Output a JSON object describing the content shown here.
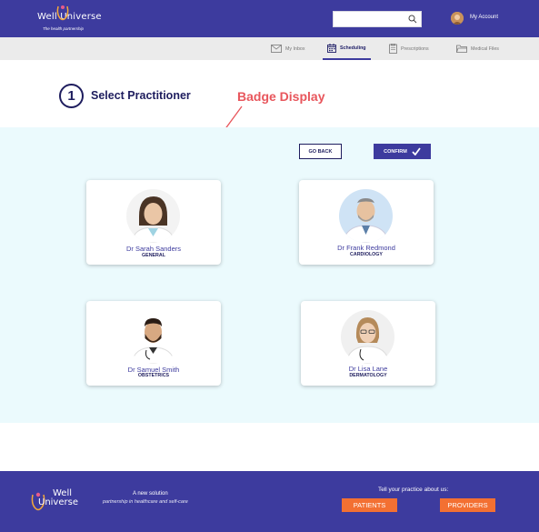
{
  "brand": {
    "name": "Well Universe",
    "tagline": "The health partnership"
  },
  "header": {
    "search_placeholder": "",
    "account_label": "My Account"
  },
  "nav": {
    "items": [
      {
        "label": "My Inbox",
        "icon": "mail-icon",
        "active": false
      },
      {
        "label": "Scheduling",
        "icon": "calendar-icon",
        "active": true
      },
      {
        "label": "Prescriptions",
        "icon": "clipboard-icon",
        "active": false
      },
      {
        "label": "Medical Files",
        "icon": "folder-icon",
        "active": false
      }
    ]
  },
  "step": {
    "number": "1",
    "title": "Select Practitioner"
  },
  "annotation": "Badge Display",
  "actions": {
    "back": "GO BACK",
    "confirm": "CONFIRM"
  },
  "practitioners": [
    {
      "name": "Dr Sarah Sanders",
      "specialty": "GENERAL"
    },
    {
      "name": "Dr Frank Redmond",
      "specialty": "CARDIOLOGY"
    },
    {
      "name": "Dr Samuel Smith",
      "specialty": "OBSTETRICS"
    },
    {
      "name": "Dr Lisa Lane",
      "specialty": "DERMATOLOGY"
    }
  ],
  "footer": {
    "logo_well": "Well",
    "logo_universe": "Universe",
    "solution_line1": "A new solution",
    "solution_line2": "partnership in healthcare and self-care",
    "tell": "Tell your practice about us:",
    "patients": "PATIENTS",
    "providers": "PROVIDERS"
  },
  "colors": {
    "brand": "#3d3b9e",
    "accent_orange": "#f37032",
    "annotation_red": "#e8565c",
    "main_bg": "#ebfafd"
  }
}
